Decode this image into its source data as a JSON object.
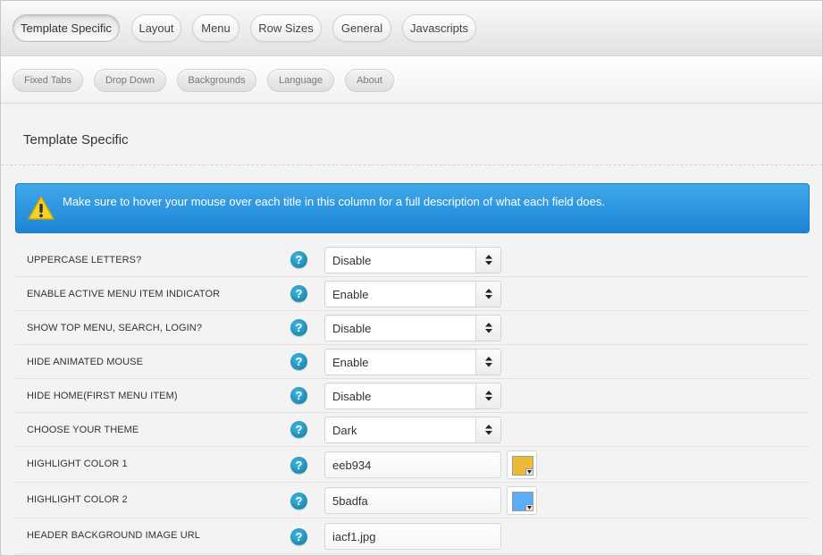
{
  "tabs_primary": [
    {
      "label": "Template Specific",
      "active": true
    },
    {
      "label": "Layout"
    },
    {
      "label": "Menu"
    },
    {
      "label": "Row Sizes"
    },
    {
      "label": "General"
    },
    {
      "label": "Javascripts"
    }
  ],
  "tabs_secondary": [
    {
      "label": "Fixed Tabs"
    },
    {
      "label": "Drop Down"
    },
    {
      "label": "Backgrounds"
    },
    {
      "label": "Language"
    },
    {
      "label": "About"
    }
  ],
  "section": {
    "title": "Template Specific"
  },
  "alert": {
    "icon": "warning-icon",
    "text": "Make sure to hover your mouse over each title in this column for a full description of what each field does.",
    "color": "#2d97e2"
  },
  "help_glyph": "?",
  "fields": [
    {
      "label": "UPPERCASE LETTERS?",
      "type": "select",
      "value": "Disable"
    },
    {
      "label": "ENABLE ACTIVE MENU ITEM INDICATOR",
      "type": "select",
      "value": "Enable"
    },
    {
      "label": "SHOW TOP MENU, SEARCH, LOGIN?",
      "type": "select",
      "value": "Disable"
    },
    {
      "label": "HIDE ANIMATED MOUSE",
      "type": "select",
      "value": "Enable"
    },
    {
      "label": "HIDE HOME(FIRST MENU ITEM)",
      "type": "select",
      "value": "Disable"
    },
    {
      "label": "CHOOSE YOUR THEME",
      "type": "select",
      "value": "Dark"
    },
    {
      "label": "HIGHLIGHT COLOR 1",
      "type": "color",
      "value": "eeb934",
      "swatch": "#eeb934"
    },
    {
      "label": "HIGHLIGHT COLOR 2",
      "type": "color",
      "value": "5badfa",
      "swatch": "#5badfa"
    },
    {
      "label": "HEADER BACKGROUND IMAGE URL",
      "type": "text",
      "value": "iacf1.jpg"
    }
  ]
}
